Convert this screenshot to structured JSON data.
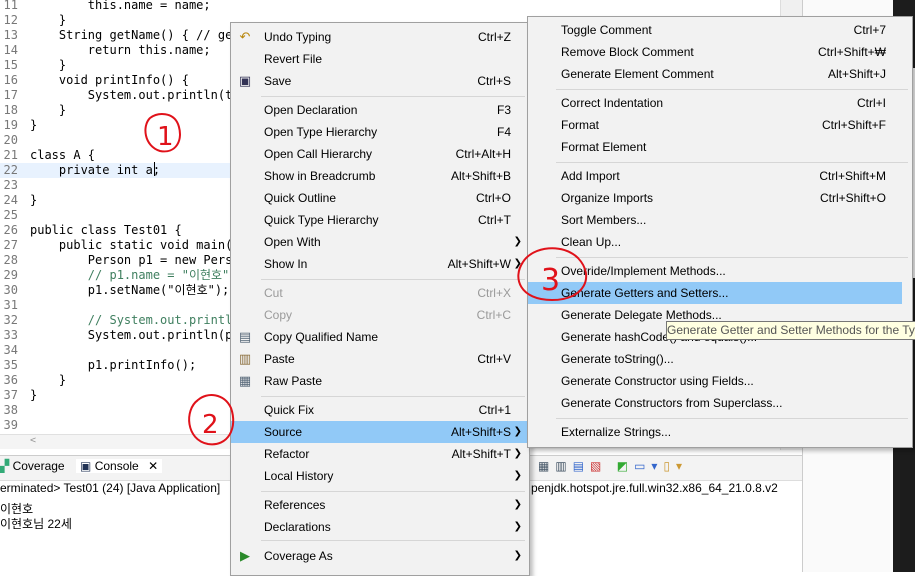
{
  "editor": {
    "lines": [
      {
        "n": "11",
        "code": "        this.name = name;"
      },
      {
        "n": "12",
        "code": "    }"
      },
      {
        "n": "13",
        "code": "    String getName() { // get"
      },
      {
        "n": "14",
        "code": "        return this.name;"
      },
      {
        "n": "15",
        "code": "    }"
      },
      {
        "n": "16",
        "code": "    void printInfo() {"
      },
      {
        "n": "17",
        "code": "        System.out.println(th"
      },
      {
        "n": "18",
        "code": "    }"
      },
      {
        "n": "19",
        "code": "}"
      },
      {
        "n": "20",
        "code": ""
      },
      {
        "n": "21",
        "code": "class A {"
      },
      {
        "n": "22",
        "code": "    private int a;"
      },
      {
        "n": "23",
        "code": ""
      },
      {
        "n": "24",
        "code": "}"
      },
      {
        "n": "25",
        "code": ""
      },
      {
        "n": "26",
        "code": "public class Test01 {"
      },
      {
        "n": "27",
        "code": "    public static void main(S"
      },
      {
        "n": "28",
        "code": "        Person p1 = new Perso"
      },
      {
        "n": "29",
        "code": "        // p1.name = \"이현호\";"
      },
      {
        "n": "30",
        "code": "        p1.setName(\"이현호\");"
      },
      {
        "n": "31",
        "code": ""
      },
      {
        "n": "32",
        "code": "        // System.out.println"
      },
      {
        "n": "33",
        "code": "        System.out.println(p1"
      },
      {
        "n": "34",
        "code": ""
      },
      {
        "n": "35",
        "code": "        p1.printInfo();"
      },
      {
        "n": "36",
        "code": "    }"
      },
      {
        "n": "37",
        "code": "}"
      },
      {
        "n": "38",
        "code": ""
      },
      {
        "n": "39",
        "code": ""
      }
    ]
  },
  "console": {
    "tabs": [
      {
        "label": "Coverage"
      },
      {
        "label": "Console"
      }
    ],
    "status_left": "erminated> Test01 (24) [Java Application]",
    "status_right": "penjdk.hotspot.jre.full.win32.x86_64_21.0.8.v2",
    "output": [
      "이현호",
      "이현호님 22세"
    ]
  },
  "menu": {
    "items": [
      {
        "label": "Undo Typing",
        "shortcut": "Ctrl+Z",
        "icon": "undo-icon"
      },
      {
        "label": "Revert File",
        "shortcut": ""
      },
      {
        "label": "Save",
        "shortcut": "Ctrl+S",
        "icon": "save-icon"
      },
      {
        "label": "Open Declaration",
        "shortcut": "F3"
      },
      {
        "label": "Open Type Hierarchy",
        "shortcut": "F4"
      },
      {
        "label": "Open Call Hierarchy",
        "shortcut": "Ctrl+Alt+H"
      },
      {
        "label": "Show in Breadcrumb",
        "shortcut": "Alt+Shift+B"
      },
      {
        "label": "Quick Outline",
        "shortcut": "Ctrl+O"
      },
      {
        "label": "Quick Type Hierarchy",
        "shortcut": "Ctrl+T"
      },
      {
        "label": "Open With",
        "shortcut": ""
      },
      {
        "label": "Show In",
        "shortcut": "Alt+Shift+W"
      },
      {
        "label": "Cut",
        "shortcut": "Ctrl+X"
      },
      {
        "label": "Copy",
        "shortcut": "Ctrl+C"
      },
      {
        "label": "Copy Qualified Name",
        "shortcut": "",
        "icon": "copy-qualified-name-icon"
      },
      {
        "label": "Paste",
        "shortcut": "Ctrl+V",
        "icon": "paste-icon"
      },
      {
        "label": "Raw Paste",
        "shortcut": "",
        "icon": "raw-paste-icon"
      },
      {
        "label": "Quick Fix",
        "shortcut": "Ctrl+1"
      },
      {
        "label": "Source",
        "shortcut": "Alt+Shift+S"
      },
      {
        "label": "Refactor",
        "shortcut": "Alt+Shift+T"
      },
      {
        "label": "Local History",
        "shortcut": ""
      },
      {
        "label": "References",
        "shortcut": ""
      },
      {
        "label": "Declarations",
        "shortcut": ""
      },
      {
        "label": "Coverage As",
        "shortcut": "",
        "icon": "coverage-icon"
      }
    ]
  },
  "submenu": {
    "items": [
      {
        "label": "Toggle Comment",
        "shortcut": "Ctrl+7"
      },
      {
        "label": "Remove Block Comment",
        "shortcut": "Ctrl+Shift+₩"
      },
      {
        "label": "Generate Element Comment",
        "shortcut": "Alt+Shift+J"
      },
      {
        "label": "Correct Indentation",
        "shortcut": "Ctrl+I"
      },
      {
        "label": "Format",
        "shortcut": "Ctrl+Shift+F"
      },
      {
        "label": "Format Element",
        "shortcut": ""
      },
      {
        "label": "Add Import",
        "shortcut": "Ctrl+Shift+M"
      },
      {
        "label": "Organize Imports",
        "shortcut": "Ctrl+Shift+O"
      },
      {
        "label": "Sort Members...",
        "shortcut": ""
      },
      {
        "label": "Clean Up...",
        "shortcut": ""
      },
      {
        "label": "Override/Implement Methods...",
        "shortcut": ""
      },
      {
        "label": "Generate Getters and Setters...",
        "shortcut": ""
      },
      {
        "label": "Generate Delegate Methods...",
        "shortcut": ""
      },
      {
        "label": "Generate hashCode() and equals()...",
        "shortcut": ""
      },
      {
        "label": "Generate toString()...",
        "shortcut": ""
      },
      {
        "label": "Generate Constructor using Fields...",
        "shortcut": ""
      },
      {
        "label": "Generate Constructors from Superclass...",
        "shortcut": ""
      },
      {
        "label": "Externalize Strings...",
        "shortcut": ""
      }
    ]
  },
  "tooltip": "Generate Getter and Setter Methods for the Ty",
  "annotations": [
    "1",
    "2",
    "3"
  ],
  "colors": {
    "selection": "#91c9f7",
    "annotation": "#e0121a",
    "keyword": "#7f0055",
    "field": "#0000c0",
    "string": "#2a00ff",
    "comment": "#3f7f5f"
  }
}
